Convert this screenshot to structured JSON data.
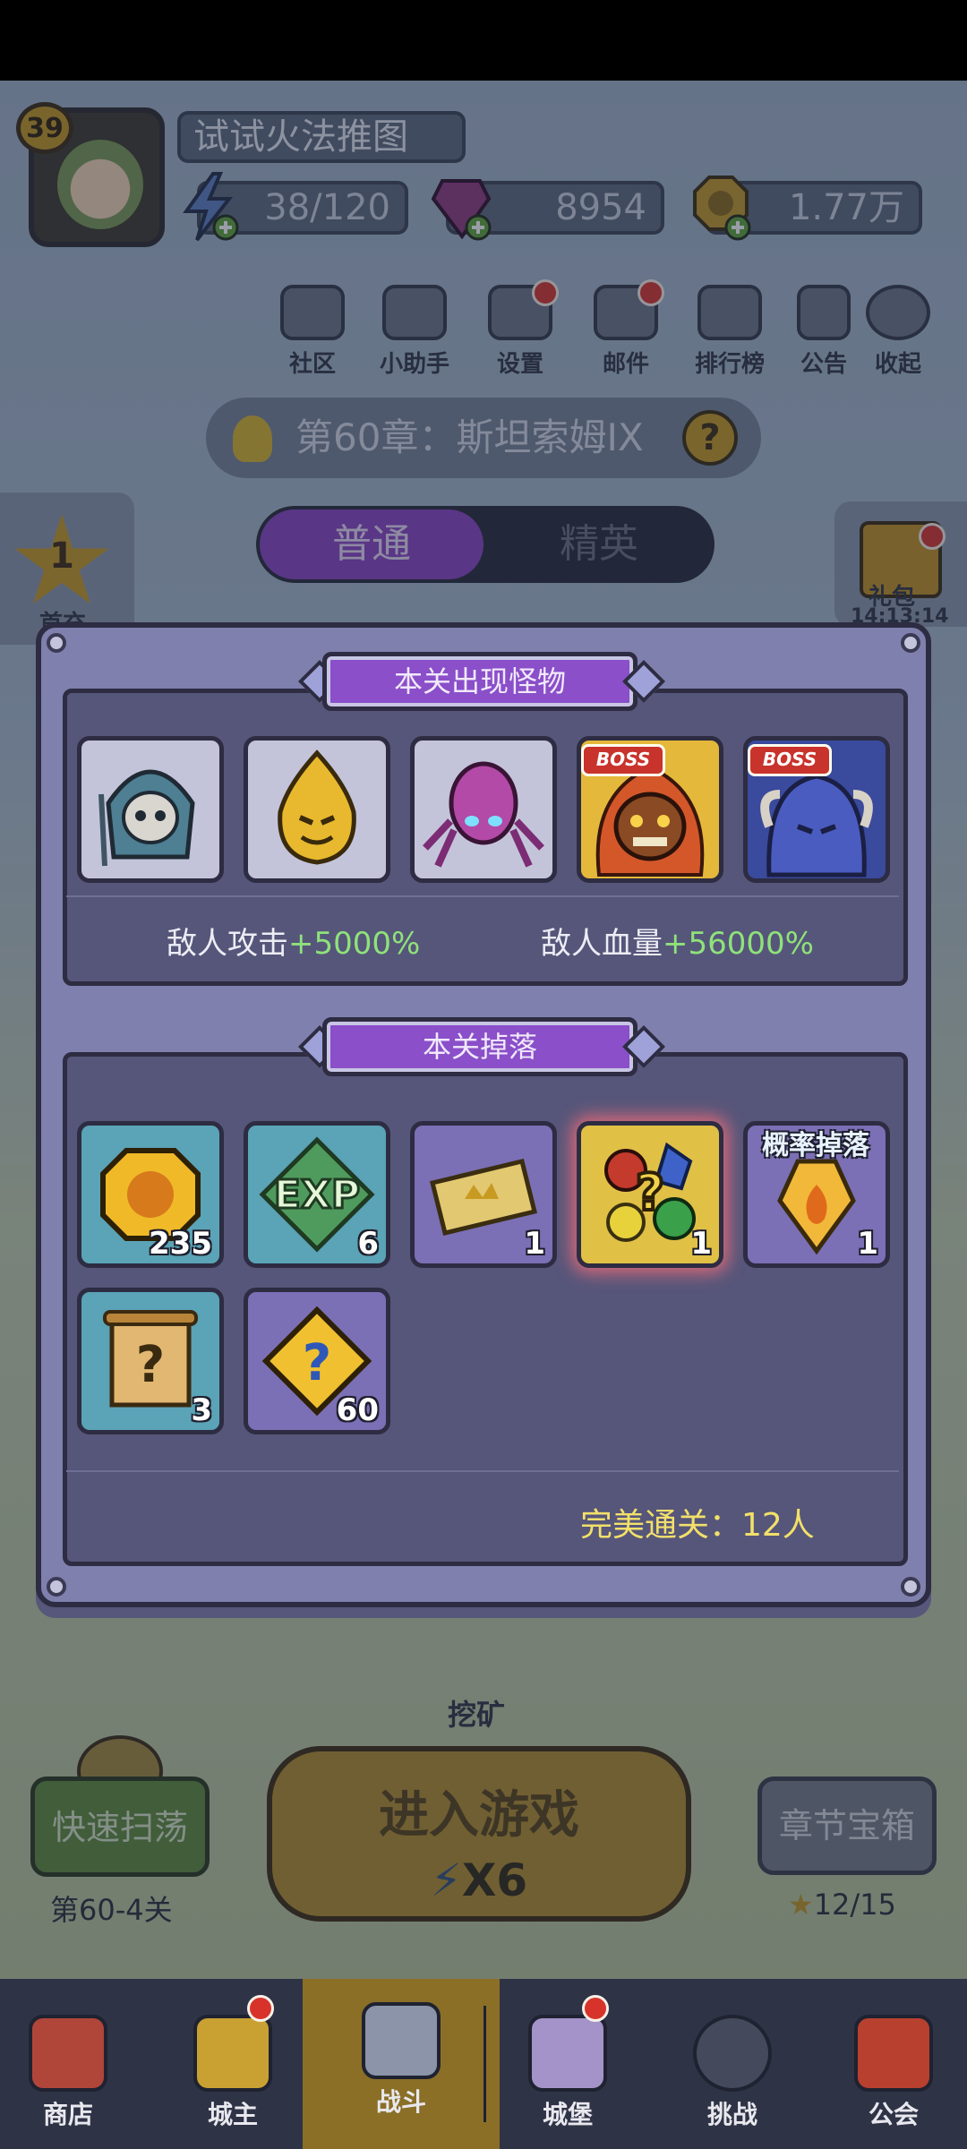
{
  "player": {
    "level": "39",
    "name": "试试火法推图"
  },
  "resources": {
    "energy": "38/120",
    "gems": "8954",
    "gold": "1.77万"
  },
  "top_menu": [
    {
      "label": "社区",
      "dot": false
    },
    {
      "label": "小助手",
      "dot": false
    },
    {
      "label": "设置",
      "dot": true
    },
    {
      "label": "邮件",
      "dot": true
    },
    {
      "label": "排行榜",
      "dot": false
    },
    {
      "label": "公告",
      "dot": false
    },
    {
      "label": "收起",
      "dot": false
    }
  ],
  "chapter": {
    "title": "第60章：斯坦索姆IX",
    "help": "?"
  },
  "mode_tabs": {
    "normal": "普通",
    "elite": "精英"
  },
  "side": {
    "first_charge_num": "1",
    "first_charge": "首充",
    "gift": "礼包",
    "gift_timer": "14:13:14"
  },
  "modal": {
    "monsters_title": "本关出现怪物",
    "monsters": [
      {
        "name": "skeleton-mage",
        "boss": false
      },
      {
        "name": "fire-spirit",
        "boss": false
      },
      {
        "name": "purple-spider",
        "boss": false
      },
      {
        "name": "flame-demon",
        "boss": true
      },
      {
        "name": "horned-ghost",
        "boss": true
      }
    ],
    "boss_label": "BOSS",
    "enemy_attack_label": "敌人攻击",
    "enemy_attack_value": "+5000%",
    "enemy_hp_label": "敌人血量",
    "enemy_hp_value": "+56000%",
    "drops_title": "本关掉落",
    "drops": [
      {
        "name": "gold-coin",
        "qty": "235",
        "bg": "blue"
      },
      {
        "name": "exp",
        "qty": "6",
        "bg": "blue"
      },
      {
        "name": "ticket",
        "qty": "1",
        "bg": "purp"
      },
      {
        "name": "random-gems",
        "qty": "1",
        "bg": "gold"
      },
      {
        "name": "flame-crystal",
        "qty": "1",
        "bg": "purp"
      },
      {
        "name": "mystery-scroll",
        "qty": "3",
        "bg": "blue"
      },
      {
        "name": "mystery-puzzle",
        "qty": "60",
        "bg": "purp"
      }
    ],
    "exp_text": "EXP",
    "probability_drop": "概率掉落",
    "perfect_clear": "完美通关：12人"
  },
  "scene": {
    "mining": "挖矿",
    "quick_sweep": "快速扫荡",
    "quick_sweep_stage": "第60-4关",
    "enter_game": "进入游戏",
    "enter_cost": "X6",
    "chapter_chest": "章节宝箱",
    "chest_progress": "12/15"
  },
  "nav": [
    {
      "label": "商店",
      "dot": false
    },
    {
      "label": "城主",
      "dot": true
    },
    {
      "label": "战斗",
      "dot": false,
      "active": true
    },
    {
      "label": "城堡",
      "dot": true
    },
    {
      "label": "挑战",
      "dot": false
    },
    {
      "label": "公会",
      "dot": false
    }
  ],
  "colors": {
    "accent_purple": "#8a4fc9",
    "bonus_green": "#8fe27a",
    "perfect_yellow": "#f2e06a",
    "boss_red": "#c8332c"
  }
}
